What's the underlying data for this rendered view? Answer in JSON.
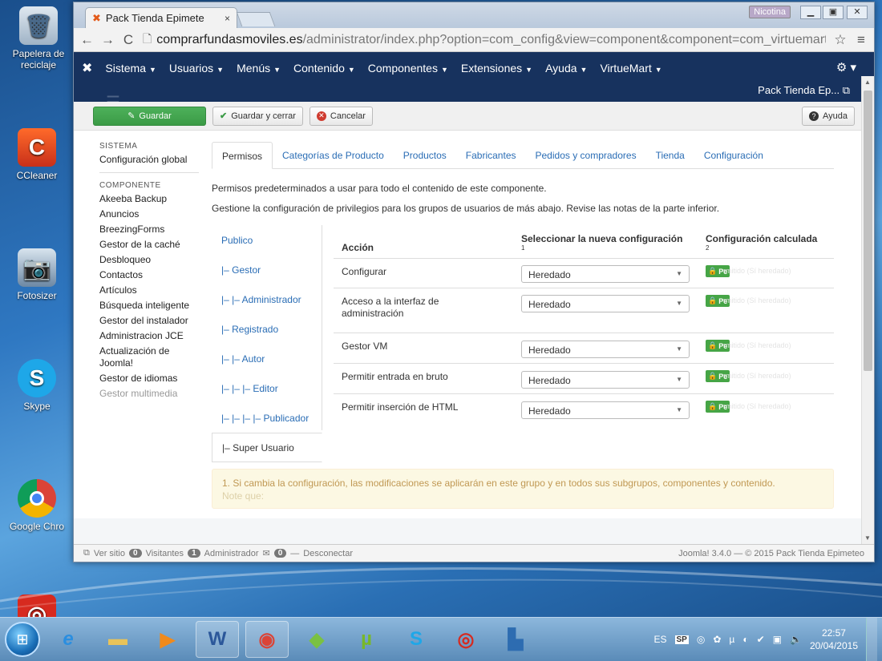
{
  "desktop": {
    "icons": [
      {
        "label": "Papelera de reciclaje",
        "icon": "recycle-bin-icon"
      },
      {
        "label": "CCleaner",
        "icon": "ccleaner-icon"
      },
      {
        "label": "Fotosizer",
        "icon": "fotosizer-icon"
      },
      {
        "label": "Skype",
        "icon": "skype-icon"
      },
      {
        "label": "Google Chro",
        "icon": "chrome-icon"
      }
    ]
  },
  "browser": {
    "tab_title": "Pack Tienda Epimete",
    "user_chip": "Nicotina",
    "url_host": "comprarfundasmoviles.es",
    "url_path": "/administrator/index.php?option=com_config&view=component&component=com_virtuemart"
  },
  "joomla_nav": {
    "items": [
      "Sistema",
      "Usuarios",
      "Menús",
      "Contenido",
      "Componentes",
      "Extensiones",
      "Ayuda",
      "VirtueMart"
    ],
    "site_link": "Pack Tienda Ep..."
  },
  "toolbar": {
    "save": "Guardar",
    "save_close": "Guardar y cerrar",
    "cancel": "Cancelar",
    "help": "Ayuda"
  },
  "sidebar": {
    "system_heading": "SISTEMA",
    "global_config": "Configuración global",
    "component_heading": "COMPONENTE",
    "components": [
      "Akeeba Backup",
      "Anuncios",
      "BreezingForms",
      "Gestor de la caché",
      "Desbloqueo",
      "Contactos",
      "Artículos",
      "Búsqueda inteligente",
      "Gestor del instalador",
      "Administracion JCE",
      "Actualización de Joomla!",
      "Gestor de idiomas",
      "Gestor multimedia"
    ]
  },
  "tabs": [
    "Permisos",
    "Categorías de Producto",
    "Productos",
    "Fabricantes",
    "Pedidos y compradores",
    "Tienda",
    "Configuración"
  ],
  "description": {
    "line1": "Permisos predeterminados a usar para todo el contenido de este componente.",
    "line2": "Gestione la configuración de privilegios para los grupos de usuarios de más abajo. Revise las notas de la parte inferior."
  },
  "groups": [
    "Publico",
    "|– Gestor",
    "|– |– Administrador",
    "|– Registrado",
    "|– |– Autor",
    "|– |– |– Editor",
    "|– |– |– |– Publicador",
    "|– Super Usuario"
  ],
  "permissions": {
    "col_action": "Acción",
    "col_new": "Seleccionar la nueva configuración",
    "col_new_note": "1",
    "col_calc": "Configuración calculada",
    "col_calc_note": "2",
    "rows": [
      {
        "action": "Configurar",
        "value": "Heredado",
        "calc": "Pe",
        "calc_note": "rmitido (Sí heredado)"
      },
      {
        "action": "Acceso a la interfaz de administración",
        "value": "Heredado",
        "calc": "Pe",
        "calc_note": "rmitido (Sí heredado)"
      },
      {
        "action": "Gestor VM",
        "value": "Heredado",
        "calc": "Pe",
        "calc_note": "rmitido (Sí heredado)"
      },
      {
        "action": "Permitir entrada en bruto",
        "value": "Heredado",
        "calc": "Pe",
        "calc_note": "rmitido (Sí heredado)"
      },
      {
        "action": "Permitir inserción de HTML",
        "value": "Heredado",
        "calc": "Pe",
        "calc_note": "rmitido (Sí heredado)"
      }
    ]
  },
  "notice": {
    "line1": "1. Si cambia la configuración, las modificaciones se aplicarán en este grupo y en todos sus subgrupos, componentes y contenido.",
    "line2": "Note que:"
  },
  "statusbar": {
    "view_site": "Ver sitio",
    "visitors_count": "0",
    "visitors": "Visitantes",
    "admin_count": "1",
    "admin": "Administrador",
    "messages_count": "0",
    "logout": "Desconectar",
    "footer": "Joomla! 3.4.0 — © 2015 Pack Tienda Epimeteo"
  },
  "taskbar": {
    "lang": "ES",
    "lang2": "SP",
    "time": "22:57",
    "date": "20/04/2015"
  },
  "colors": {
    "joomla_nav": "#17325e",
    "save_green": "#46a546",
    "link_blue": "#2a6db5",
    "notice_bg": "#fcf8e3"
  }
}
